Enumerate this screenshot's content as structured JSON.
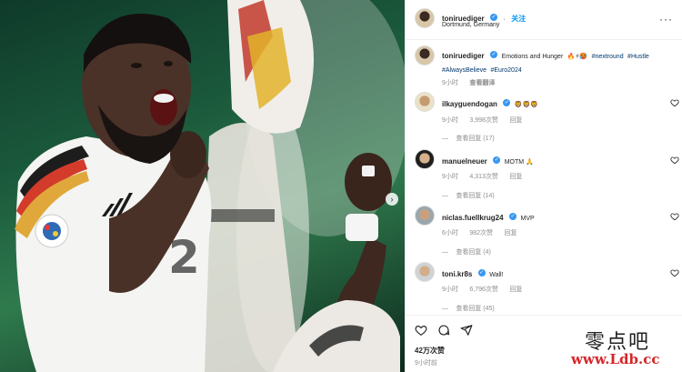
{
  "post": {
    "username": "toniruediger",
    "follow_label": "关注",
    "location": "Dortmund, Germany",
    "caption_text": "Emotions and Hunger",
    "caption_emojis": "🔥⚡🥵",
    "hashtags": [
      "#nextround",
      "#Hustle",
      "#AlwaysBelieve",
      "#Euro2024"
    ],
    "caption_time": "9小时",
    "translate_label": "查看翻译"
  },
  "comments": [
    {
      "username": "ilkayguendogan",
      "text": "🦁🦁🦁",
      "time": "9小时",
      "likes": "3,998次赞",
      "reply_label": "回复",
      "view_replies": "查看回复 (17)"
    },
    {
      "username": "manuelneuer",
      "text": "MOTM 🙏",
      "time": "9小时",
      "likes": "4,313次赞",
      "reply_label": "回复",
      "view_replies": "查看回复 (14)"
    },
    {
      "username": "niclas.fuellkrug24",
      "text": "MVP",
      "time": "6小时",
      "likes": "982次赞",
      "reply_label": "回复",
      "view_replies": "查看回复 (4)"
    },
    {
      "username": "toni.kr8s",
      "text": "Wall!",
      "time": "9小时",
      "likes": "6,796次赞",
      "reply_label": "回复",
      "view_replies": "查看回复 (45)"
    }
  ],
  "actions": {
    "icons": [
      "heart-icon",
      "comment-icon",
      "share-icon"
    ],
    "likes_total": "42万次赞",
    "post_time": "9小时前"
  },
  "watermark": {
    "cn": "零点吧",
    "url": "www.Ldb.cc"
  },
  "colors": {
    "link_blue": "#0095f6",
    "hashtag_blue": "#00376b",
    "verified_blue": "#3897f0",
    "meta_gray": "#8e8e8e",
    "watermark_red": "#d4262a"
  }
}
